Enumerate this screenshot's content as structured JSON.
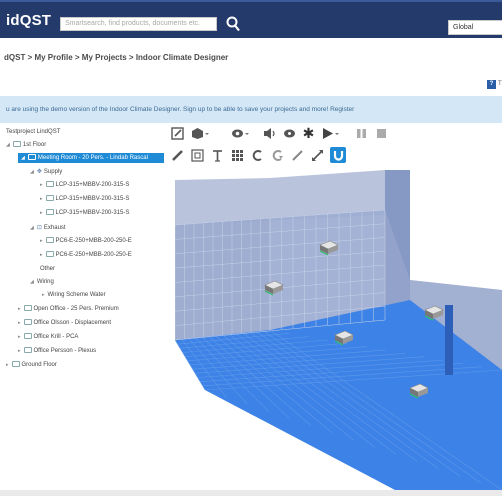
{
  "header": {
    "brand": "idQST",
    "search_placeholder": "Smartsearch, find products, documents etc.",
    "region": "Global"
  },
  "breadcrumb": "dQST > My Profile > My Projects > Indoor Climate Designer",
  "help_letter": "T",
  "demo_banner": "u are using the demo version of the Indoor Climate Designer. Sign up to be able to save your projects and more! Register",
  "tree": {
    "project": "Testproject LindQST",
    "floor1": "1st Floor",
    "room_selected": "Meeting Room - 20 Pers. - Lindab Rascal",
    "supply": "Supply",
    "supply_items": [
      "LCP-315+MBBV-200-315-S",
      "LCP-315+MBBV-200-315-S",
      "LCP-315+MBBV-200-315-S"
    ],
    "exhaust": "Exhaust",
    "exhaust_items": [
      "PC6-E-250+MBB-200-250-E",
      "PC6-E-250+MBB-200-250-E"
    ],
    "other": "Other",
    "wiring": "Wiring",
    "wiring_scheme": "Wiring Scheme Water",
    "offices": [
      "Open Office - 25 Pers. Premium",
      "Office Olsson - Displacement",
      "Office Krill - PCA",
      "Office Persson - Plexus"
    ],
    "ground_floor": "Ground Floor"
  },
  "colors": {
    "header_bg": "#243a6b",
    "banner_bg": "#d4e7f6",
    "selected": "#1f8ad6",
    "floor": "#3d82e6",
    "wall": "#8ea0c8"
  },
  "toolbar_icons": [
    "edit-icon",
    "cube-icon",
    "view-icon",
    "sound-icon",
    "eye-settings-icon",
    "star-icon",
    "play-icon",
    "pause-icon",
    "stop-icon",
    "pencil-icon",
    "grid-icon",
    "text-icon",
    "table-icon",
    "rotate-left-icon",
    "rotate-right-icon",
    "measure-icon",
    "resize-icon",
    "magnet-icon"
  ]
}
